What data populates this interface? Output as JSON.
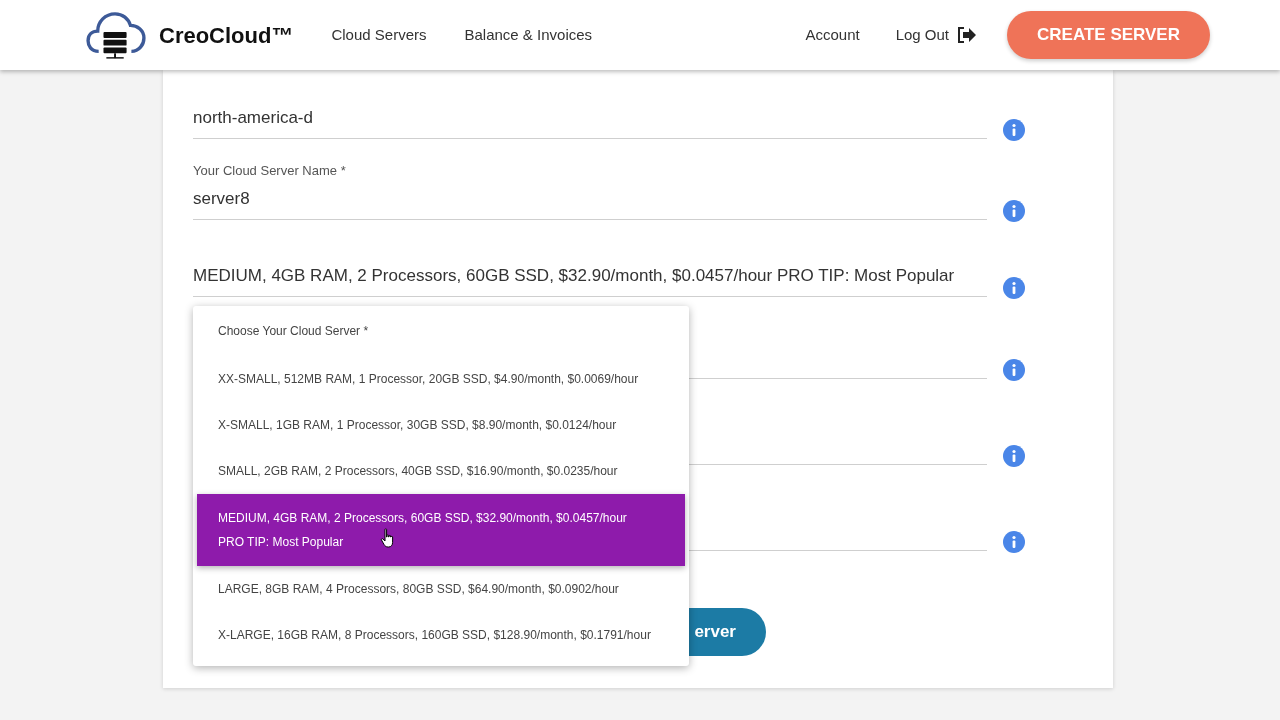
{
  "navbar": {
    "brand": "CreoCloud™",
    "links": [
      "Cloud Servers",
      "Balance & Invoices"
    ],
    "right_links": [
      "Account",
      "Log Out"
    ],
    "cta": "CREATE SERVER"
  },
  "fields": [
    {
      "kind": "text",
      "value": "north-america-d"
    },
    {
      "kind": "text",
      "label": "Your Cloud Server Name *",
      "value": "server8"
    },
    {
      "kind": "select",
      "value": "MEDIUM, 4GB RAM, 2 Processors, 60GB SSD, $32.90/month, $0.0457/hour PRO TIP: Most Popular"
    },
    {
      "kind": "covered"
    },
    {
      "kind": "covered"
    },
    {
      "kind": "covered"
    }
  ],
  "submit_button": "erver",
  "dropdown": {
    "header": "Choose Your Cloud Server *",
    "options": [
      {
        "label": "XX-SMALL, 512MB RAM, 1 Processor, 20GB SSD, $4.90/month, $0.0069/hour",
        "selected": false
      },
      {
        "label": "X-SMALL, 1GB RAM, 1 Processor, 30GB SSD, $8.90/month, $0.0124/hour",
        "selected": false
      },
      {
        "label": "SMALL, 2GB RAM, 2 Processors, 40GB SSD, $16.90/month, $0.0235/hour",
        "selected": false
      },
      {
        "label": "MEDIUM, 4GB RAM, 2 Processors, 60GB SSD, $32.90/month, $0.0457/hour",
        "tip": "PRO TIP: Most Popular",
        "selected": true
      },
      {
        "label": "LARGE, 8GB RAM, 4 Processors, 80GB SSD, $64.90/month, $0.0902/hour",
        "selected": false
      },
      {
        "label": "X-LARGE, 16GB RAM, 8 Processors, 160GB SSD, $128.90/month, $0.1791/hour",
        "selected": false
      }
    ]
  }
}
